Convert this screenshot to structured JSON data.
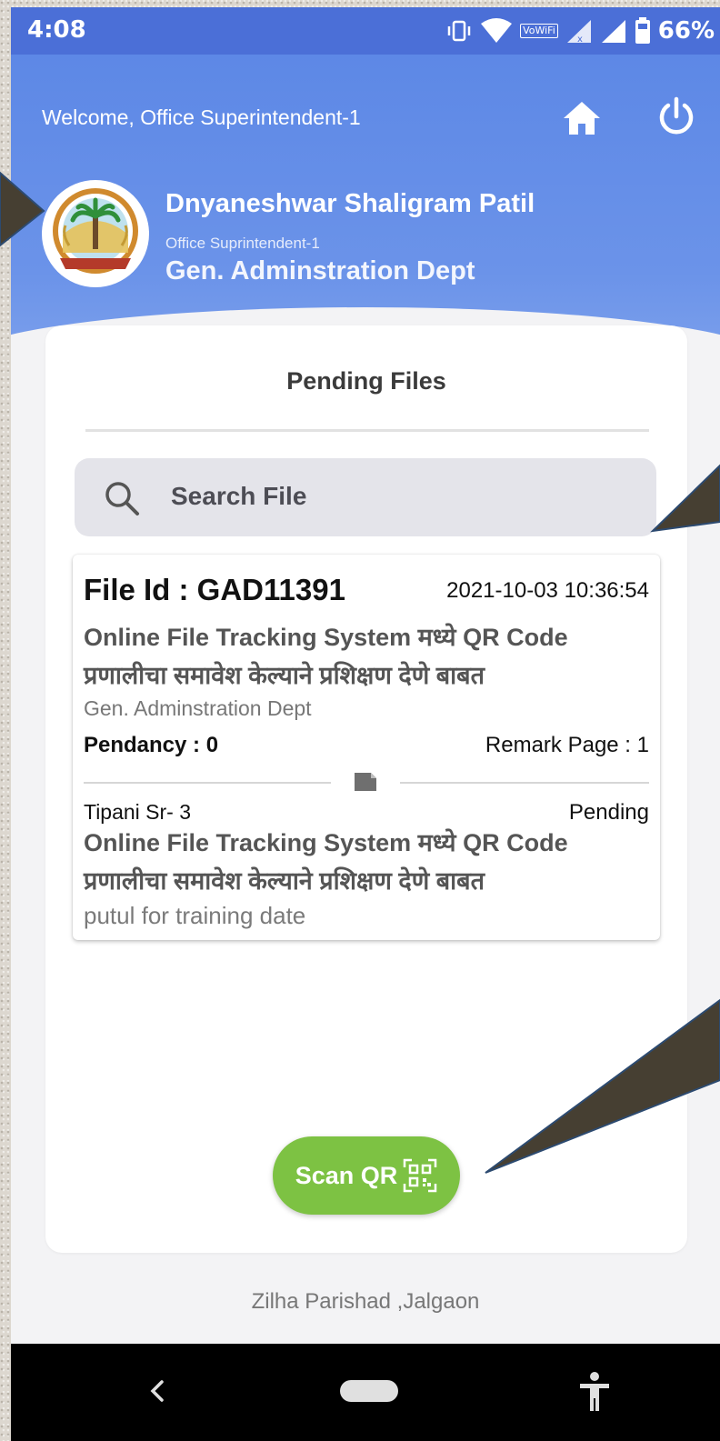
{
  "status_bar": {
    "time": "4:08",
    "battery_percent": "66%",
    "vowifi_label": "VoWiFi",
    "icons": [
      "vibrate-icon",
      "wifi-icon",
      "signal-icon",
      "signal-icon",
      "battery-icon"
    ]
  },
  "header": {
    "welcome_text": "Welcome, Office Superintendent-1",
    "home_icon": "home-icon",
    "logout_icon": "power-icon"
  },
  "user": {
    "name": "Dnyaneshwar Shaligram Patil",
    "role": "Office Suprintendent-1",
    "department": "Gen. Adminstration Dept",
    "avatar_icon": "zilla-parishad-logo"
  },
  "main": {
    "title": "Pending Files",
    "search": {
      "placeholder": "Search File",
      "value": ""
    },
    "files": [
      {
        "file_id": "File Id : GAD11391",
        "date": "2021-10-03 10:36:54",
        "subject": "Online File Tracking System मध्ये QR Code प्रणालीचा समावेश केल्याने प्रशिक्षण देणे बाबत",
        "department": "Gen. Adminstration Dept",
        "pendancy": "Pendancy : 0",
        "remark_page": "Remark Page : 1",
        "note": {
          "tipani": "Tipani Sr- 3",
          "status": "Pending",
          "subject": "Online File Tracking System मध्ये QR Code प्रणालीचा समावेश केल्याने प्रशिक्षण देणे बाबत",
          "remark": "putul for training date"
        }
      }
    ],
    "scan_button_label": "Scan QR"
  },
  "footer": {
    "organization": "Zilha Parishad ,Jalgaon"
  },
  "nav_bar": {
    "icons": [
      "back-icon",
      "home-pill-icon",
      "accessibility-icon"
    ]
  },
  "colors": {
    "status_bar": "#4b6fd7",
    "header": "#5d88e6",
    "scan_button": "#7dc243",
    "annotation_arrow": "#463f32"
  }
}
